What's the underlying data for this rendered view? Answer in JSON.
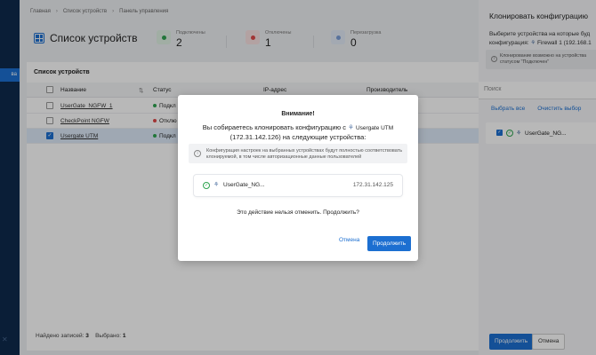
{
  "sidebar": {
    "active_label": "ва"
  },
  "breadcrumb": [
    "Главная",
    "Список устройств",
    "Панель управления"
  ],
  "page_title": "Список устройств",
  "stats": [
    {
      "label": "Подключены",
      "count": "2",
      "color": "#2ea44f",
      "bg": "#dff1e3"
    },
    {
      "label": "Отключены",
      "count": "1",
      "color": "#e04848",
      "bg": "#f8e1e1"
    },
    {
      "label": "Перезагрузка",
      "count": "0",
      "color": "#7a9fd8",
      "bg": "#e2eaf7"
    }
  ],
  "table": {
    "title": "Список устройств",
    "columns": {
      "name": "Название",
      "status": "Статус",
      "ip": "IP-адрес",
      "vendor": "Производитель"
    },
    "rows": [
      {
        "name": "UserGate_NGFW_1",
        "status": "Подкл",
        "status_color": "#2ea44f",
        "checked": false
      },
      {
        "name": "CheckPoint NGFW",
        "status": "Отклю",
        "status_color": "#e04848",
        "checked": false
      },
      {
        "name": "Usergate UTM",
        "status": "Подкл",
        "status_color": "#2ea44f",
        "checked": true
      }
    ]
  },
  "footer": {
    "records_label": "Найдено записей:",
    "records": "3",
    "selected_label": "Выбрано:",
    "selected": "1"
  },
  "drawer": {
    "title": "Клонировать конфигурацию",
    "subtitle_1": "Выберите устройства на которые буд",
    "subtitle_2_prefix": "конфигурация:",
    "source_device": "Firewall 1 (192.168.1",
    "info_1": "Клонирование возможно на устройства",
    "info_2": "статусом \"Подключен\"",
    "search_placeholder": "Поиск",
    "select_all": "Выбрать все",
    "clear_selection": "Очистить выбор",
    "item_name": "UserGate_NG...",
    "continue": "Продолжить",
    "cancel": "Отмена"
  },
  "modal": {
    "title": "Внимание!",
    "text_prefix": "Вы собираетесь клонировать конфигурацию с",
    "source_name": "Usergate UTM",
    "text_suffix": "(172.31.142.126) на следующие устройства:",
    "warning_1": "Конфигурация настроек на выбранных устройствах будут полностью соответствовать",
    "warning_2": "клонируемой, в том числе авторизационные данные пользователей",
    "device_name": "UserGate_NG...",
    "device_ip": "172.31.142.125",
    "question": "Это действие нельзя отменить. Продолжить?",
    "cancel": "Отмена",
    "ok": "Продолжить"
  }
}
